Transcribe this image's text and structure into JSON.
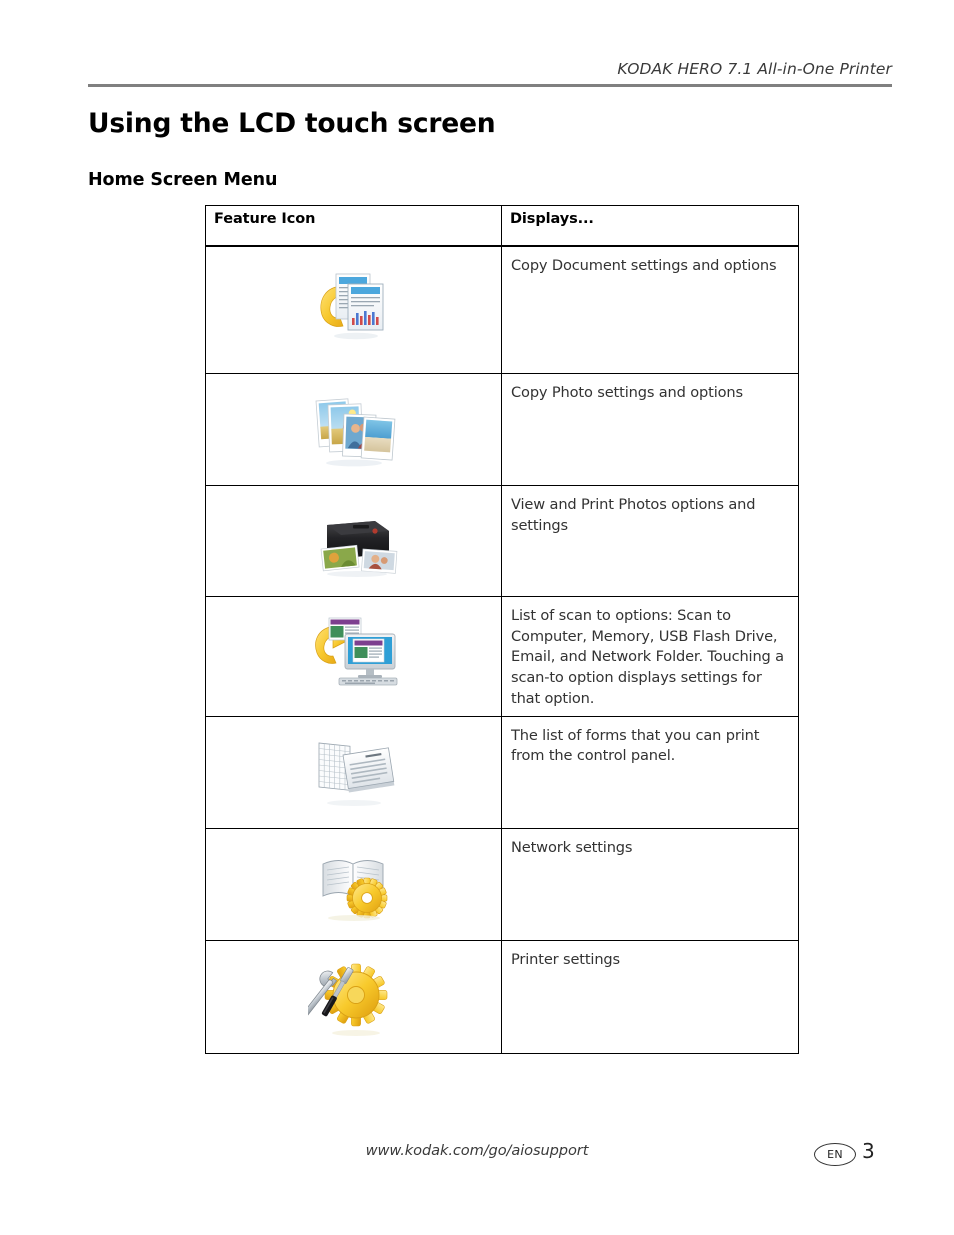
{
  "document": {
    "running_head": "KODAK HERO 7.1 All-in-One Printer",
    "title": "Using the LCD touch screen",
    "subtitle": "Home Screen Menu"
  },
  "table": {
    "headers": {
      "icon": "Feature Icon",
      "displays": "Displays..."
    },
    "rows": [
      {
        "icon_name": "copy-document-icon",
        "description": "Copy Document settings and options"
      },
      {
        "icon_name": "copy-photo-icon",
        "description": "Copy Photo settings and options"
      },
      {
        "icon_name": "view-and-print-photos-icon",
        "description": "View and Print Photos options and settings"
      },
      {
        "icon_name": "scan-icon",
        "description": "List of scan to options: Scan to Computer, Memory, USB Flash Drive, Email, and Network Folder. Touching a scan-to option displays settings for that option."
      },
      {
        "icon_name": "forms-icon",
        "description": "The list of forms that you can print from the control panel."
      },
      {
        "icon_name": "network-settings-icon",
        "description": "Network settings"
      },
      {
        "icon_name": "printer-settings-icon",
        "description": "Printer settings"
      }
    ]
  },
  "footer": {
    "url": "www.kodak.com/go/aiosupport",
    "language": "EN",
    "page_number": "3"
  },
  "colors": {
    "rule": "#808080",
    "text": "#231f20",
    "accent_gold": "#f5c518",
    "accent_blue": "#3a9fd8"
  }
}
